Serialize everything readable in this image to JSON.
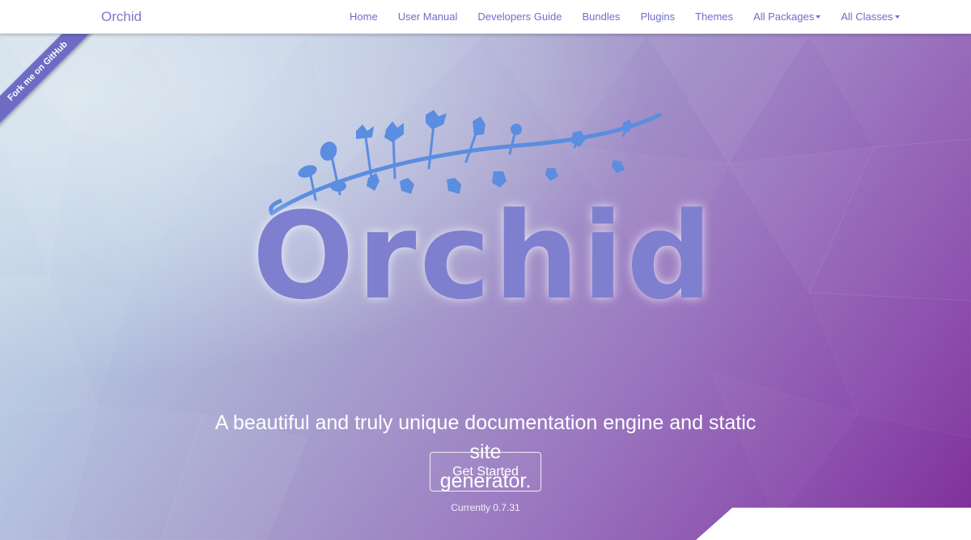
{
  "navbar": {
    "brand": "Orchid",
    "links": [
      {
        "label": "Home"
      },
      {
        "label": "User Manual"
      },
      {
        "label": "Developers Guide"
      },
      {
        "label": "Bundles"
      },
      {
        "label": "Plugins"
      },
      {
        "label": "Themes"
      },
      {
        "label": "All Packages",
        "dropdown": true
      },
      {
        "label": "All Classes",
        "dropdown": true
      }
    ]
  },
  "ribbon": {
    "label": "Fork me on GitHub"
  },
  "hero": {
    "logo_text": "Orchid",
    "tagline_line1": "A beautiful and truly unique documentation engine and static site",
    "tagline_line2": "generator.",
    "cta_label": "Get Started",
    "version_text": "Currently 0.7.31"
  },
  "colors": {
    "brand": "#7a79cc",
    "logo_fill": "#7f7fd0",
    "branch": "#5b8de0",
    "ribbon": "#6d6bc4"
  }
}
